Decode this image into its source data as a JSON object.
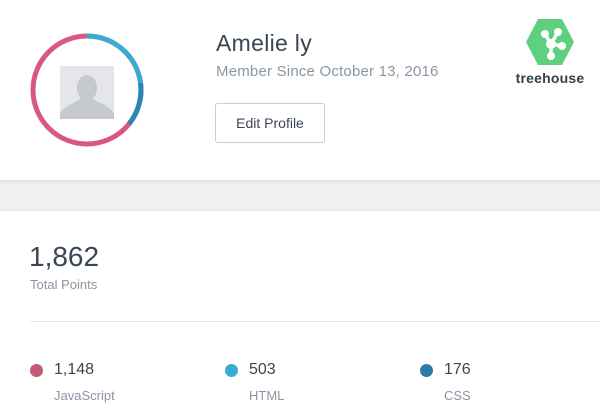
{
  "profile": {
    "name": "Amelie ly",
    "member_since": "Member Since October 13, 2016",
    "edit_button": "Edit Profile",
    "avatar_icon": "user-silhouette-icon"
  },
  "brand": {
    "logo_text": "treehouse",
    "logo_icon": "frog-foot-icon",
    "color": "#5fcf80"
  },
  "stats": {
    "total_points": "1,862",
    "total_label": "Total Points",
    "topics": [
      {
        "value": "1,148",
        "label": "JavaScript",
        "color": "#c25975"
      },
      {
        "value": "503",
        "label": "HTML",
        "color": "#39add1"
      },
      {
        "value": "176",
        "label": "CSS",
        "color": "#3079ab"
      }
    ]
  }
}
